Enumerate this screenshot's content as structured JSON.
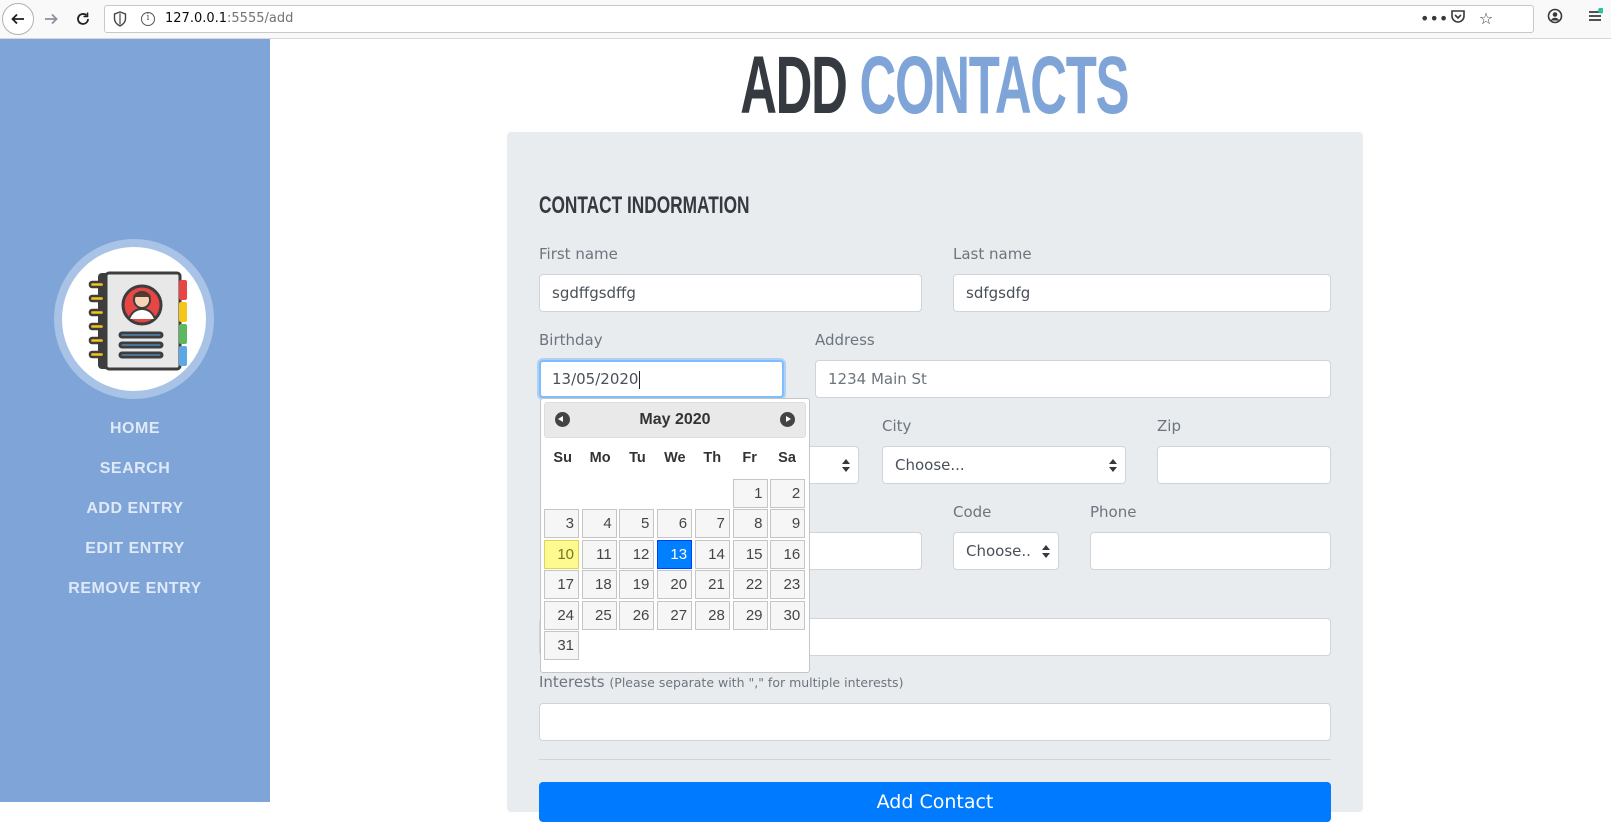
{
  "browser": {
    "url_host": "127.0.0.1",
    "url_path": ":5555/add"
  },
  "sidebar": {
    "items": [
      {
        "label": "HOME"
      },
      {
        "label": "SEARCH"
      },
      {
        "label": "ADD ENTRY"
      },
      {
        "label": "EDIT ENTRY"
      },
      {
        "label": "REMOVE ENTRY"
      }
    ]
  },
  "page": {
    "title_part1": "ADD",
    "title_part2": "CONTACTS"
  },
  "form": {
    "section_title": "CONTACT INDORMATION",
    "first_name": {
      "label": "First name",
      "value": "sgdffgsdffg"
    },
    "last_name": {
      "label": "Last name",
      "value": "sdfgsdfg"
    },
    "birthday": {
      "label": "Birthday",
      "value": "13/05/2020"
    },
    "address": {
      "label": "Address",
      "placeholder": "1234 Main St"
    },
    "city": {
      "label": "City",
      "value": "Choose..."
    },
    "zip": {
      "label": "Zip",
      "value": ""
    },
    "code": {
      "label": "Code",
      "value": "Choose.."
    },
    "phone": {
      "label": "Phone",
      "value": ""
    },
    "interests": {
      "label": "Interests",
      "hint": "(Please separate with \",\" for multiple interests)",
      "value": ""
    },
    "submit_label": "Add Contact"
  },
  "datepicker": {
    "month_label": "May 2020",
    "days_of_week": [
      "Su",
      "Mo",
      "Tu",
      "We",
      "Th",
      "Fr",
      "Sa"
    ],
    "first_weekday_index": 5,
    "days_in_month": 31,
    "today": 10,
    "selected": 13
  },
  "colors": {
    "sidebar": "#7fa4d7",
    "accent": "#007bff",
    "title_dark": "#343a40",
    "title_light": "#7fa4d7"
  }
}
